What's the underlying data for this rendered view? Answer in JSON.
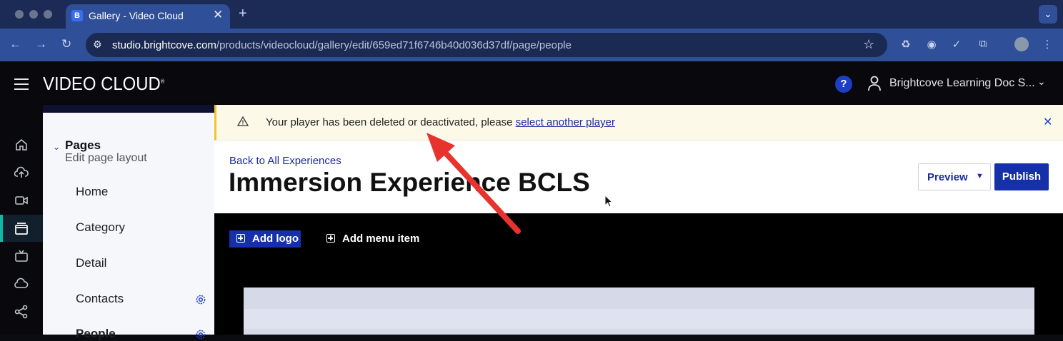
{
  "browser": {
    "tab_title": "Gallery - Video Cloud",
    "tab_favicon": "B",
    "url_host": "studio.brightcove.com",
    "url_path": "/products/videocloud/gallery/edit/659ed71f6746b40d036d37df/page/people"
  },
  "app": {
    "brand": "VIDEO CLOUD",
    "brand_mark": "®",
    "help_label": "?",
    "account_name": "Brightcove Learning Doc S..."
  },
  "rail": {
    "icons": [
      "home-icon",
      "upload-icon",
      "media-icon",
      "gallery-icon",
      "live-icon",
      "cloud-playout-icon",
      "social-icon"
    ],
    "active": "gallery-icon",
    "accent_color": "#0fb9a6"
  },
  "pages_panel": {
    "title": "Pages",
    "subtitle": "Edit page layout",
    "items": [
      {
        "label": "Home"
      },
      {
        "label": "Category"
      },
      {
        "label": "Detail"
      },
      {
        "label": "Contacts"
      },
      {
        "label": "People"
      }
    ]
  },
  "alert": {
    "message": "Your player has been deleted or deactivated, please ",
    "link_text": "select another player",
    "close_label": "✕"
  },
  "experience": {
    "back_link": "Back to All Experiences",
    "title": "Immersion Experience BCLS",
    "preview_label": "Preview",
    "publish_label": "Publish"
  },
  "stage": {
    "add_logo_label": "Add logo",
    "add_menu_item_label": "Add menu item"
  },
  "colors": {
    "primary": "#1530a8",
    "link": "#1b2ba1",
    "alert_bg": "#fdf9e8",
    "alert_border": "#f2c230",
    "annotation_arrow": "#e8322d"
  }
}
